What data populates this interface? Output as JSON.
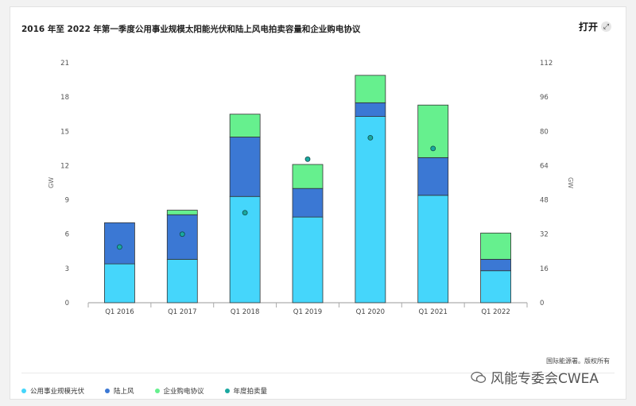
{
  "header": {
    "title": "2016 年至 2022 年第一季度公用事业规模太阳能光伏和陆上风电拍卖容量和企业购电协议",
    "open_label": "打开"
  },
  "source": "国际能源署。版权所有",
  "watermark": "风能专委会CWEA",
  "colors": {
    "solar": "#45d6fb",
    "wind": "#3b78d4",
    "ppa": "#66f08e",
    "annual": "#1aa8a0"
  },
  "chart_data": {
    "type": "bar",
    "stacked": true,
    "categories": [
      "Q1 2016",
      "Q1 2017",
      "Q1 2018",
      "Q1 2019",
      "Q1 2020",
      "Q1 2021",
      "Q1 2022"
    ],
    "series": [
      {
        "name": "公用事业规模光伏",
        "values": [
          3.4,
          3.8,
          9.3,
          7.5,
          16.3,
          9.4,
          2.8
        ]
      },
      {
        "name": "陆上风",
        "values": [
          3.6,
          3.9,
          5.2,
          2.5,
          1.2,
          3.3,
          1.0
        ]
      },
      {
        "name": "企业购电协议",
        "values": [
          0.0,
          0.4,
          2.0,
          2.1,
          2.4,
          4.6,
          2.3
        ]
      }
    ],
    "line_series": {
      "name": "年度拍卖量",
      "axis": "right",
      "values": [
        26,
        32,
        42,
        67,
        77,
        72,
        null
      ]
    },
    "ylabel": "GW",
    "ylim": [
      0,
      21
    ],
    "yticks": [
      0,
      3,
      6,
      9,
      12,
      15,
      18,
      21
    ],
    "y2label": "GW",
    "y2lim": [
      0,
      112
    ],
    "y2ticks": [
      0,
      16,
      32,
      48,
      64,
      80,
      96,
      112
    ],
    "grid": false,
    "legend": "bottom-left"
  }
}
